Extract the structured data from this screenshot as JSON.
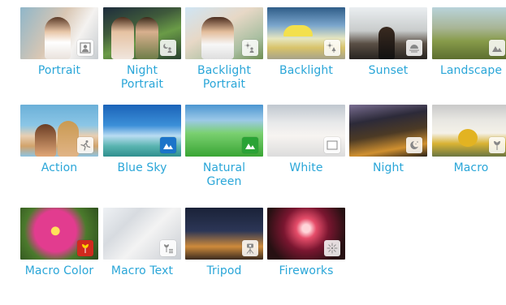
{
  "scenes": [
    {
      "label": "Portrait",
      "icon": "portrait-icon"
    },
    {
      "label": "Night\nPortrait",
      "icon": "night-portrait-icon"
    },
    {
      "label": "Backlight\nPortrait",
      "icon": "backlight-portrait-icon"
    },
    {
      "label": "Backlight",
      "icon": "backlight-icon"
    },
    {
      "label": "Sunset",
      "icon": "sunset-icon"
    },
    {
      "label": "Landscape",
      "icon": "landscape-icon"
    },
    {
      "label": "Action",
      "icon": "action-icon"
    },
    {
      "label": "Blue Sky",
      "icon": "blue-sky-icon"
    },
    {
      "label": "Natural\nGreen",
      "icon": "natural-green-icon"
    },
    {
      "label": "White",
      "icon": "white-icon"
    },
    {
      "label": "Night",
      "icon": "night-icon"
    },
    {
      "label": "Macro",
      "icon": "macro-icon"
    },
    {
      "label": "Macro Color",
      "icon": "macro-color-icon"
    },
    {
      "label": "Macro Text",
      "icon": "macro-text-icon"
    },
    {
      "label": "Tripod",
      "icon": "tripod-icon"
    },
    {
      "label": "Fireworks",
      "icon": "fireworks-icon"
    }
  ],
  "colors": {
    "label": "#2aa6d8",
    "badge_blue": "#1b74c9",
    "badge_green": "#2aa335",
    "badge_red": "#d02a1d"
  }
}
